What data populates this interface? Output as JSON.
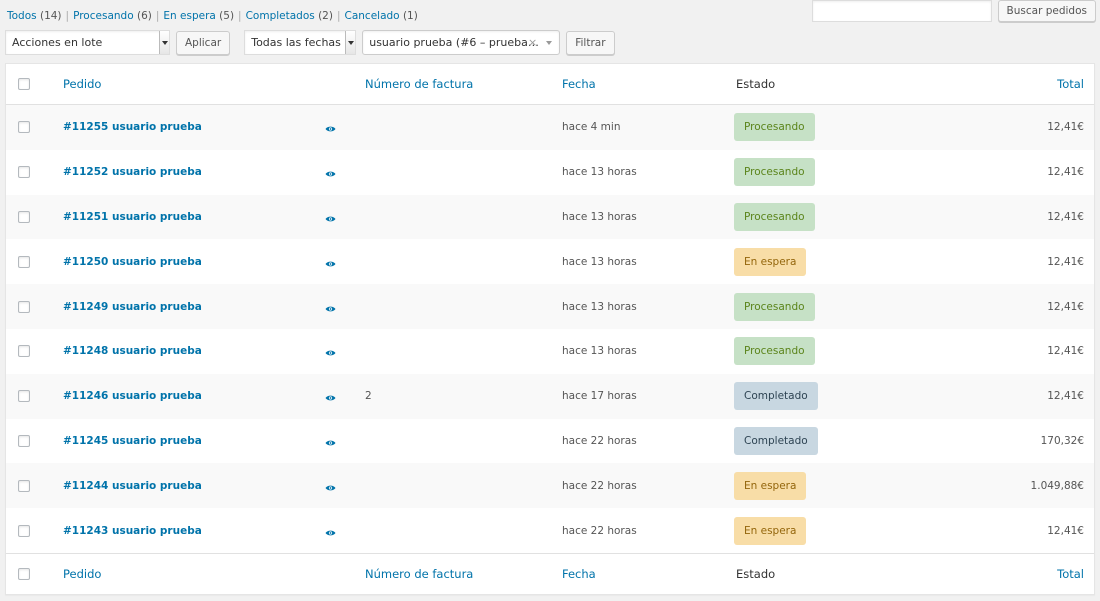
{
  "filters": [
    {
      "label": "Todos",
      "count": "(14)"
    },
    {
      "label": "Procesando",
      "count": "(6)"
    },
    {
      "label": "En espera",
      "count": "(5)"
    },
    {
      "label": "Completados",
      "count": "(2)"
    },
    {
      "label": "Cancelado",
      "count": "(1)"
    }
  ],
  "search": {
    "placeholder": "",
    "button": "Buscar pedidos"
  },
  "toolbar": {
    "bulk_actions": "Acciones en lote",
    "apply": "Aplicar",
    "dates": "Todas las fechas",
    "customer": "usuario prueba (#6 – prueba…",
    "clear": "×",
    "filter": "Filtrar"
  },
  "columns": {
    "order": "Pedido",
    "invoice": "Número de factura",
    "date": "Fecha",
    "status": "Estado",
    "total": "Total"
  },
  "colors": {
    "link": "#0073aa",
    "processing_bg": "#c6e1c6",
    "processing_fg": "#5b841b",
    "on_hold_bg": "#f8dda7",
    "on_hold_fg": "#94660c",
    "completed_bg": "#c8d7e1",
    "completed_fg": "#2e4453"
  },
  "orders": [
    {
      "order": "#11255 usuario prueba",
      "invoice": "",
      "date": "hace 4 min",
      "status": "Procesando",
      "status_key": "processing",
      "total": "12,41€"
    },
    {
      "order": "#11252 usuario prueba",
      "invoice": "",
      "date": "hace 13 horas",
      "status": "Procesando",
      "status_key": "processing",
      "total": "12,41€"
    },
    {
      "order": "#11251 usuario prueba",
      "invoice": "",
      "date": "hace 13 horas",
      "status": "Procesando",
      "status_key": "processing",
      "total": "12,41€"
    },
    {
      "order": "#11250 usuario prueba",
      "invoice": "",
      "date": "hace 13 horas",
      "status": "En espera",
      "status_key": "on-hold",
      "total": "12,41€"
    },
    {
      "order": "#11249 usuario prueba",
      "invoice": "",
      "date": "hace 13 horas",
      "status": "Procesando",
      "status_key": "processing",
      "total": "12,41€"
    },
    {
      "order": "#11248 usuario prueba",
      "invoice": "",
      "date": "hace 13 horas",
      "status": "Procesando",
      "status_key": "processing",
      "total": "12,41€"
    },
    {
      "order": "#11246 usuario prueba",
      "invoice": "2",
      "date": "hace 17 horas",
      "status": "Completado",
      "status_key": "completed",
      "total": "12,41€"
    },
    {
      "order": "#11245 usuario prueba",
      "invoice": "",
      "date": "hace 22 horas",
      "status": "Completado",
      "status_key": "completed",
      "total": "170,32€"
    },
    {
      "order": "#11244 usuario prueba",
      "invoice": "",
      "date": "hace 22 horas",
      "status": "En espera",
      "status_key": "on-hold",
      "total": "1.049,88€"
    },
    {
      "order": "#11243 usuario prueba",
      "invoice": "",
      "date": "hace 22 horas",
      "status": "En espera",
      "status_key": "on-hold",
      "total": "12,41€"
    }
  ]
}
